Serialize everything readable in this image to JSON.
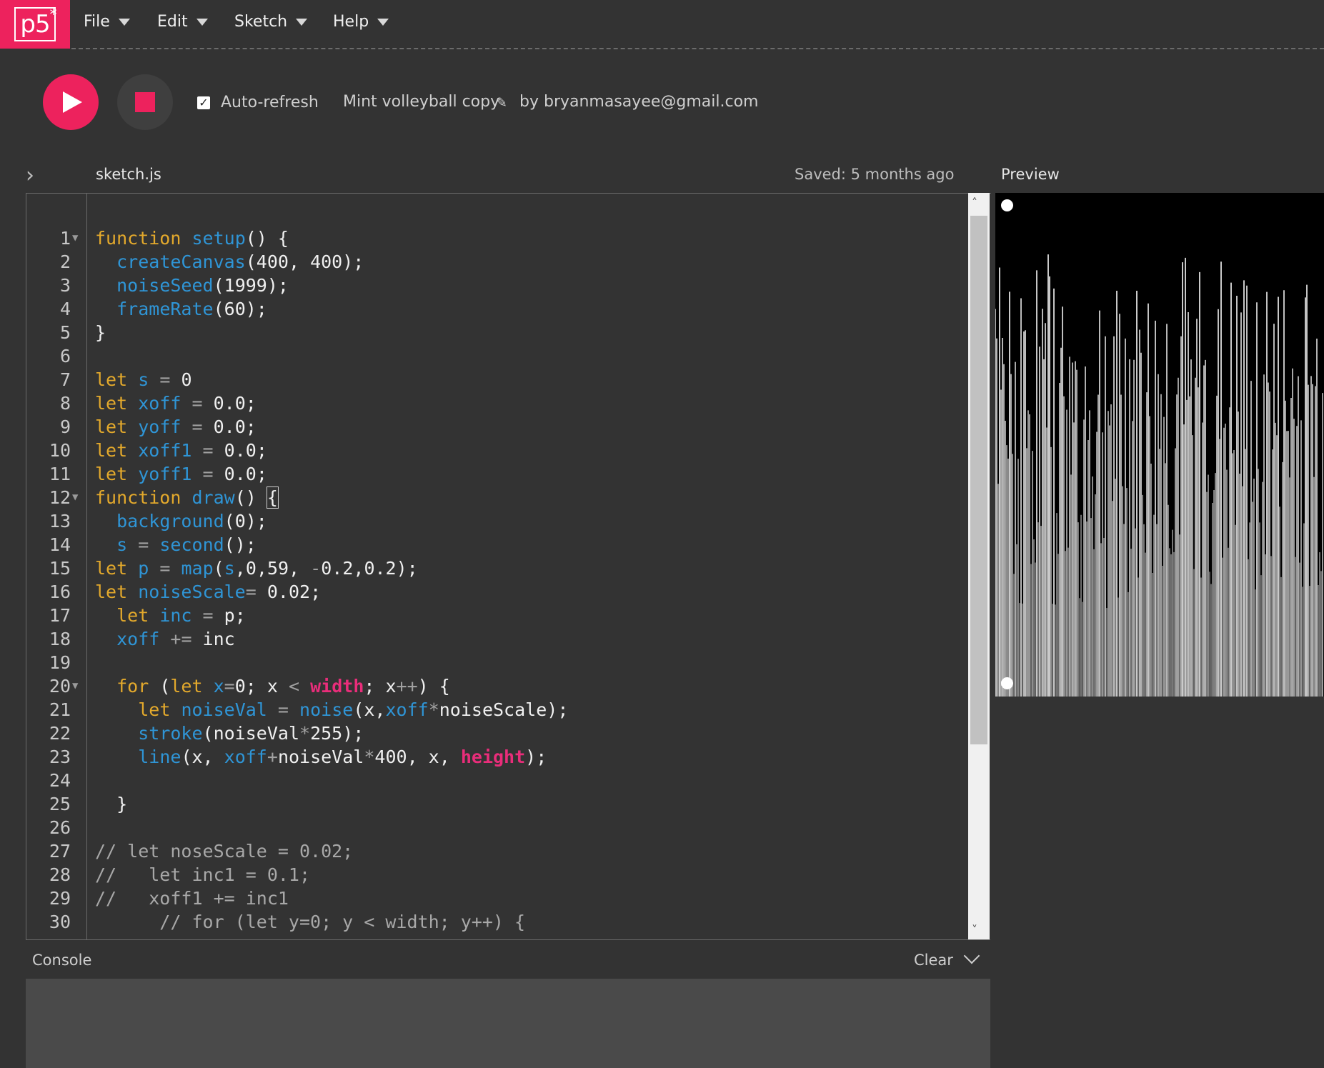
{
  "nav": {
    "logo": "p5",
    "logo_star": "*",
    "menu": [
      {
        "label": "File"
      },
      {
        "label": "Edit"
      },
      {
        "label": "Sketch"
      },
      {
        "label": "Help"
      }
    ]
  },
  "toolbar": {
    "auto_refresh_label": "Auto-refresh",
    "auto_refresh_checked": true,
    "project_name": "Mint volleyball copy",
    "owner": "by bryanmasayee@gmail.com"
  },
  "editor": {
    "file_name": "sketch.js",
    "saved_status": "Saved: 5 months ago",
    "lines": [
      {
        "n": "1",
        "fold": true,
        "t": "function setup() {"
      },
      {
        "n": "2",
        "t": "  createCanvas(400, 400);"
      },
      {
        "n": "3",
        "t": "  noiseSeed(1999);"
      },
      {
        "n": "4",
        "t": "  frameRate(60);"
      },
      {
        "n": "5",
        "t": "}"
      },
      {
        "n": "6",
        "t": ""
      },
      {
        "n": "7",
        "t": "let s = 0"
      },
      {
        "n": "8",
        "t": "let xoff = 0.0;"
      },
      {
        "n": "9",
        "t": "let yoff = 0.0;"
      },
      {
        "n": "10",
        "t": "let xoff1 = 0.0;"
      },
      {
        "n": "11",
        "t": "let yoff1 = 0.0;"
      },
      {
        "n": "12",
        "fold": true,
        "t": "function draw() {"
      },
      {
        "n": "13",
        "t": "  background(0);"
      },
      {
        "n": "14",
        "t": "  s = second();"
      },
      {
        "n": "15",
        "t": "let p = map(s,0,59, -0.2,0.2);"
      },
      {
        "n": "16",
        "t": "let noiseScale= 0.02;"
      },
      {
        "n": "17",
        "t": "  let inc = p;"
      },
      {
        "n": "18",
        "t": "  xoff += inc"
      },
      {
        "n": "19",
        "t": ""
      },
      {
        "n": "20",
        "fold": true,
        "t": "  for (let x=0; x < width; x++) {"
      },
      {
        "n": "21",
        "t": "    let noiseVal = noise(x,xoff*noiseScale);"
      },
      {
        "n": "22",
        "t": "    stroke(noiseVal*255);"
      },
      {
        "n": "23",
        "t": "    line(x, xoff+noiseVal*400, x, height);"
      },
      {
        "n": "24",
        "t": ""
      },
      {
        "n": "25",
        "t": "  }"
      },
      {
        "n": "26",
        "t": ""
      },
      {
        "n": "27",
        "t": "// let noseScale = 0.02;"
      },
      {
        "n": "28",
        "t": "//   let inc1 = 0.1;"
      },
      {
        "n": "29",
        "t": "//   xoff1 += inc1"
      },
      {
        "n": "30",
        "t": "      // for (let y=0; y < width; y++) {"
      }
    ]
  },
  "preview": {
    "label": "Preview"
  },
  "console": {
    "title": "Console",
    "clear_label": "Clear"
  },
  "colors": {
    "accent": "#ed225d",
    "keyword": "#e3a92c",
    "function": "#2f95d6",
    "builtin_const": "#e92d7a",
    "background": "#333333"
  }
}
